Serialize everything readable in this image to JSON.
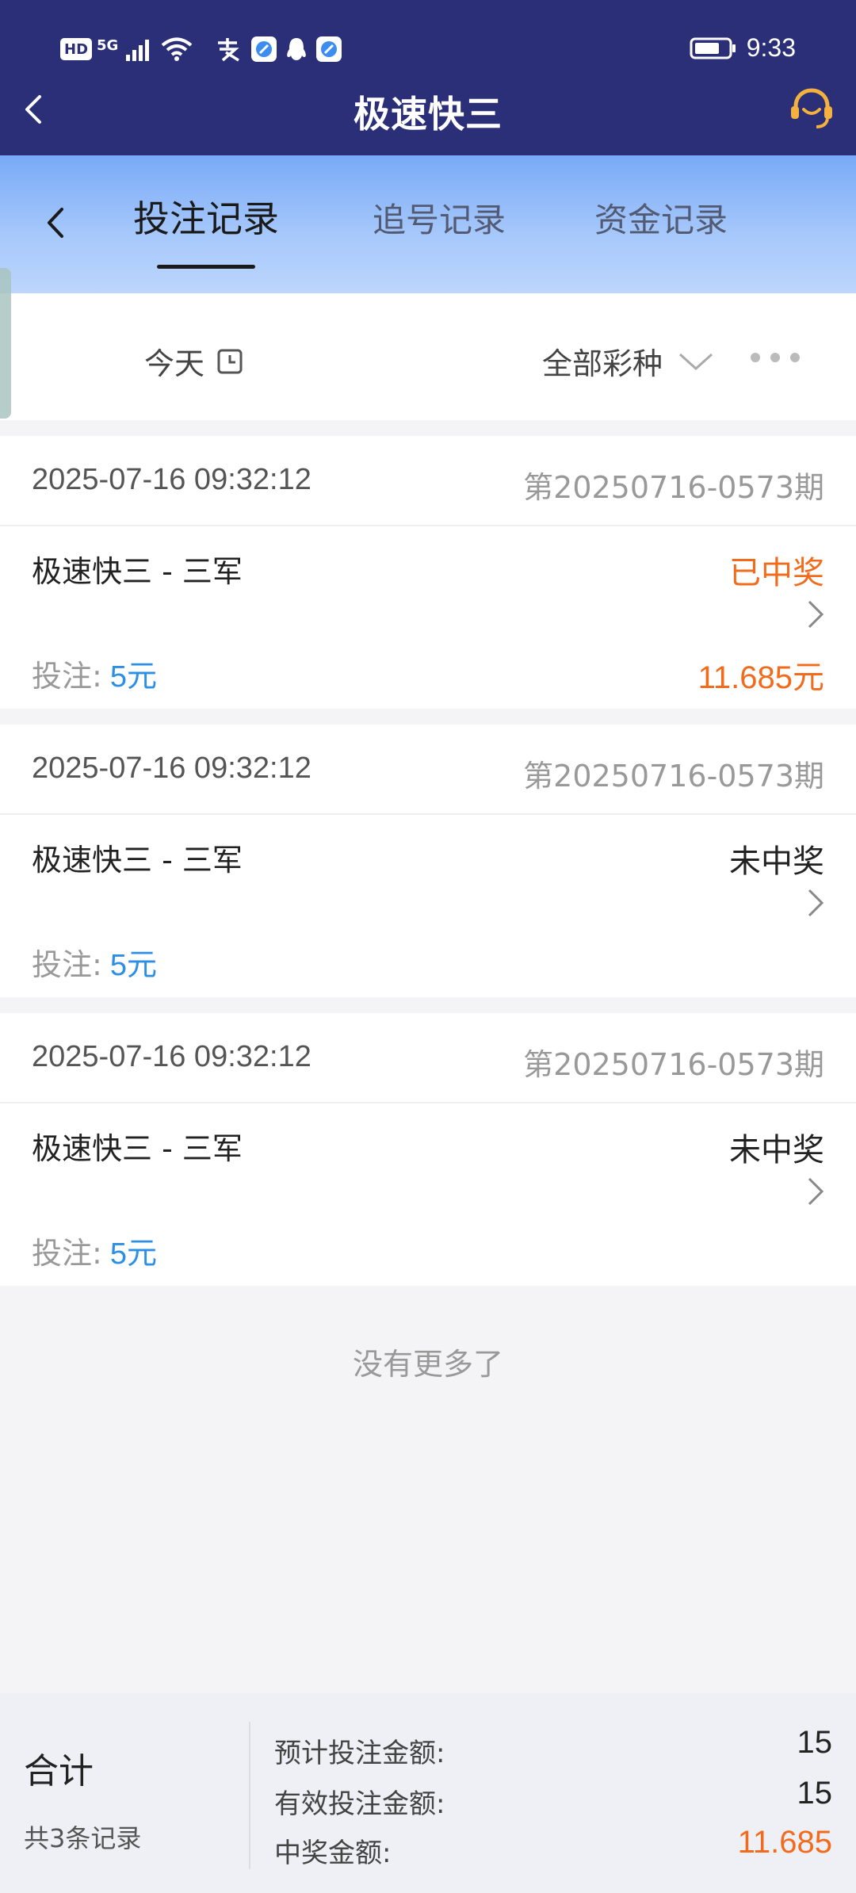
{
  "status_bar": {
    "hd": "HD",
    "network": "5G",
    "time": "9:33"
  },
  "nav": {
    "title": "极速快三"
  },
  "tabs": [
    {
      "label": "投注记录",
      "active": true
    },
    {
      "label": "追号记录",
      "active": false
    },
    {
      "label": "资金记录",
      "active": false
    }
  ],
  "filter": {
    "date_label": "今天",
    "type_label": "全部彩种"
  },
  "records": [
    {
      "time": "2025-07-16 09:32:12",
      "issue": "第20250716-0573期",
      "name": "极速快三 - 三军",
      "status": "已中奖",
      "bet_label": "投注:",
      "bet_amount": "5元",
      "prize": "11.685元"
    },
    {
      "time": "2025-07-16 09:32:12",
      "issue": "第20250716-0573期",
      "name": "极速快三 - 三军",
      "status": "未中奖",
      "bet_label": "投注:",
      "bet_amount": "5元",
      "prize": ""
    },
    {
      "time": "2025-07-16 09:32:12",
      "issue": "第20250716-0573期",
      "name": "极速快三 - 三军",
      "status": "未中奖",
      "bet_label": "投注:",
      "bet_amount": "5元",
      "prize": ""
    }
  ],
  "no_more": "没有更多了",
  "summary": {
    "total_label": "合计",
    "count_label": "共3条记录",
    "rows": [
      {
        "label": "预计投注金额:",
        "value": "15"
      },
      {
        "label": "有效投注金额:",
        "value": "15"
      },
      {
        "label": "中奖金额:",
        "value": "11.685"
      }
    ]
  },
  "colors": {
    "header_bg": "#2a2f78",
    "accent_orange": "#f26b1d",
    "accent_blue": "#2d8ee6"
  }
}
